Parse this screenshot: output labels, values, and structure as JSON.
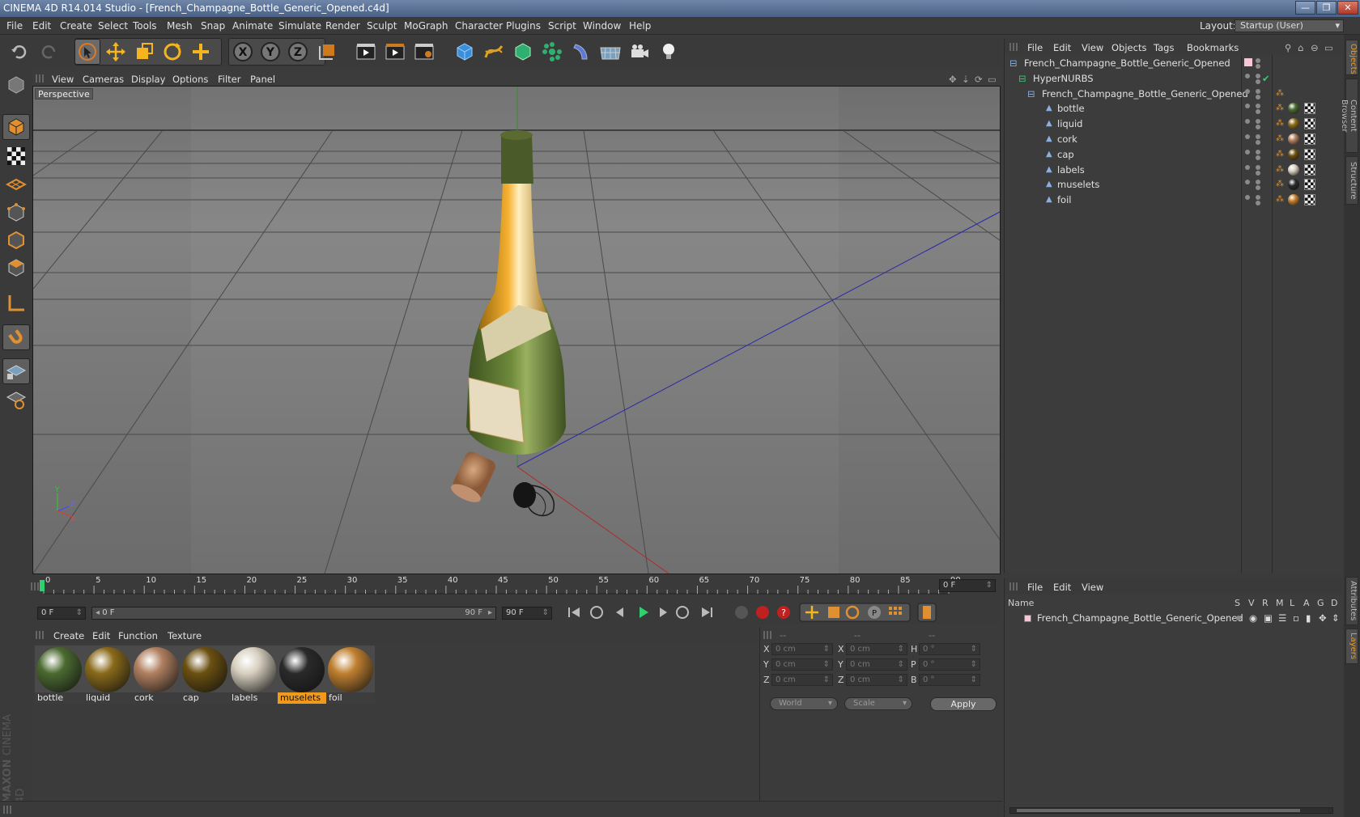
{
  "title": "CINEMA 4D R14.014 Studio - [French_Champagne_Bottle_Generic_Opened.c4d]",
  "window_controls": {
    "minimize": "—",
    "restore": "❐",
    "close": "✕"
  },
  "menu": [
    "File",
    "Edit",
    "Create",
    "Select",
    "Tools",
    "Mesh",
    "Snap",
    "Animate",
    "Simulate",
    "Render",
    "Sculpt",
    "MoGraph",
    "Character",
    "Plugins",
    "Script",
    "Window",
    "Help"
  ],
  "layout": {
    "label": "Layout:",
    "value": "Startup (User)"
  },
  "viewport": {
    "menu": [
      "View",
      "Cameras",
      "Display",
      "Options",
      "Filter",
      "Panel"
    ],
    "label": "Perspective"
  },
  "toolbar_icons": [
    "undo-icon",
    "redo-icon",
    "live-selection-icon",
    "move-icon",
    "scale-icon",
    "rotate-icon",
    "add-icon",
    "x-axis-icon",
    "y-axis-icon",
    "z-axis-icon",
    "coordinate-system-icon",
    "render-view-icon",
    "render-picture-viewer-icon",
    "edit-render-settings-icon",
    "cube-icon",
    "spline-icon",
    "nurbs-icon",
    "array-icon",
    "deformer-icon",
    "floor-icon",
    "camera-icon",
    "light-icon"
  ],
  "timeline": {
    "ticks": [
      "0",
      "5",
      "10",
      "15",
      "20",
      "25",
      "30",
      "35",
      "40",
      "45",
      "50",
      "55",
      "60",
      "65",
      "70",
      "75",
      "80",
      "85",
      "90"
    ],
    "current_frame": "0 F",
    "start": "0 F",
    "range_start": "0 F",
    "range_end": "90 F",
    "end": "90 F"
  },
  "materials": {
    "menu": [
      "Create",
      "Edit",
      "Function",
      "Texture"
    ],
    "items": [
      {
        "name": "bottle",
        "color": "#4b6a30"
      },
      {
        "name": "liquid",
        "color": "#8a6a1a"
      },
      {
        "name": "cork",
        "color": "#b08060"
      },
      {
        "name": "cap",
        "color": "#6b5010"
      },
      {
        "name": "labels",
        "color": "#d8d0c0"
      },
      {
        "name": "muselets",
        "color": "#2a2a2a"
      },
      {
        "name": "foil",
        "color": "#c08030"
      }
    ],
    "active": "muselets"
  },
  "coords": {
    "header": [
      "--",
      "--",
      "--"
    ],
    "rows": [
      {
        "a": "X",
        "av": "0 cm",
        "b": "X",
        "bv": "0 cm",
        "c": "H",
        "cv": "0 °"
      },
      {
        "a": "Y",
        "av": "0 cm",
        "b": "Y",
        "bv": "0 cm",
        "c": "P",
        "cv": "0 °"
      },
      {
        "a": "Z",
        "av": "0 cm",
        "b": "Z",
        "bv": "0 cm",
        "c": "B",
        "cv": "0 °"
      }
    ],
    "mode": "World",
    "transform": "Scale",
    "apply": "Apply"
  },
  "objects": {
    "menu": [
      "File",
      "Edit",
      "View",
      "Objects",
      "Tags",
      "Bookmarks"
    ],
    "tree": [
      {
        "name": "French_Champagne_Bottle_Generic_Opened",
        "indent": 0
      },
      {
        "name": "HyperNURBS",
        "indent": 1
      },
      {
        "name": "French_Champagne_Bottle_Generic_Opened",
        "indent": 2
      },
      {
        "name": "bottle",
        "indent": 3,
        "mat": "#4b6a30"
      },
      {
        "name": "liquid",
        "indent": 3,
        "mat": "#8a6a1a"
      },
      {
        "name": "cork",
        "indent": 3,
        "mat": "#b08060"
      },
      {
        "name": "cap",
        "indent": 3,
        "mat": "#6b5010"
      },
      {
        "name": "labels",
        "indent": 3,
        "mat": "#d8d0c0"
      },
      {
        "name": "muselets",
        "indent": 3,
        "mat": "#2a2a2a"
      },
      {
        "name": "foil",
        "indent": 3,
        "mat": "#c08030"
      }
    ]
  },
  "layers": {
    "menu": [
      "File",
      "Edit",
      "View"
    ],
    "header_name": "Name",
    "header_cols": [
      "S",
      "V",
      "R",
      "M",
      "L",
      "A",
      "G",
      "D"
    ],
    "rows": [
      {
        "name": "French_Champagne_Bottle_Generic_Opened"
      }
    ]
  },
  "side_tabs": [
    "Objects",
    "Content Browser",
    "Structure",
    "Attributes",
    "Layers"
  ],
  "brand": {
    "line1": "MAXON",
    "line2": "CINEMA 4D"
  },
  "colors": {
    "accent": "#f09a1b",
    "panel": "#3b3b3b"
  }
}
